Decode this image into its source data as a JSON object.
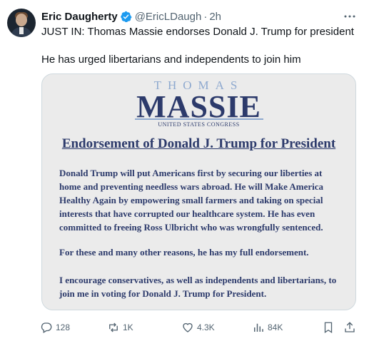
{
  "tweet": {
    "author_name": "Eric Daugherty",
    "handle": "@EricLDaugh",
    "separator": "·",
    "time": "2h",
    "text_line1": "JUST IN: Thomas Massie endorses Donald J. Trump for president",
    "text_line2": "He has urged libertarians and independents to join him"
  },
  "image": {
    "logo_top": "THOMAS",
    "logo_main": "MASSIE",
    "logo_sub": "UNITED STATES CONGRESS",
    "title": "Endorsement of Donald J. Trump for President",
    "para1": "Donald Trump will put Americans first by securing our liberties at home and preventing needless wars abroad. He will Make America Healthy Again by empowering small farmers and taking on special interests that have corrupted our healthcare system. He has even committed to freeing Ross Ulbricht who was wrongfully sentenced.",
    "para2": "For these and many other reasons, he has my full endorsement.",
    "para3": "I encourage conservatives, as well as independents and libertarians, to join me in voting for Donald J. Trump for President."
  },
  "actions": {
    "replies": "128",
    "reposts": "1K",
    "likes": "4.3K",
    "views": "84K"
  },
  "icons": {
    "verified": "verified-badge-icon",
    "more": "more-dots-icon",
    "reply": "reply-icon",
    "repost": "repost-icon",
    "like": "heart-icon",
    "views": "views-bar-icon",
    "bookmark": "bookmark-icon",
    "share": "share-icon"
  },
  "colors": {
    "verified": "#1d9bf0",
    "muted": "#536471",
    "doc_navy": "#2c3a6b",
    "doc_light_blue": "#8ea9cf"
  }
}
